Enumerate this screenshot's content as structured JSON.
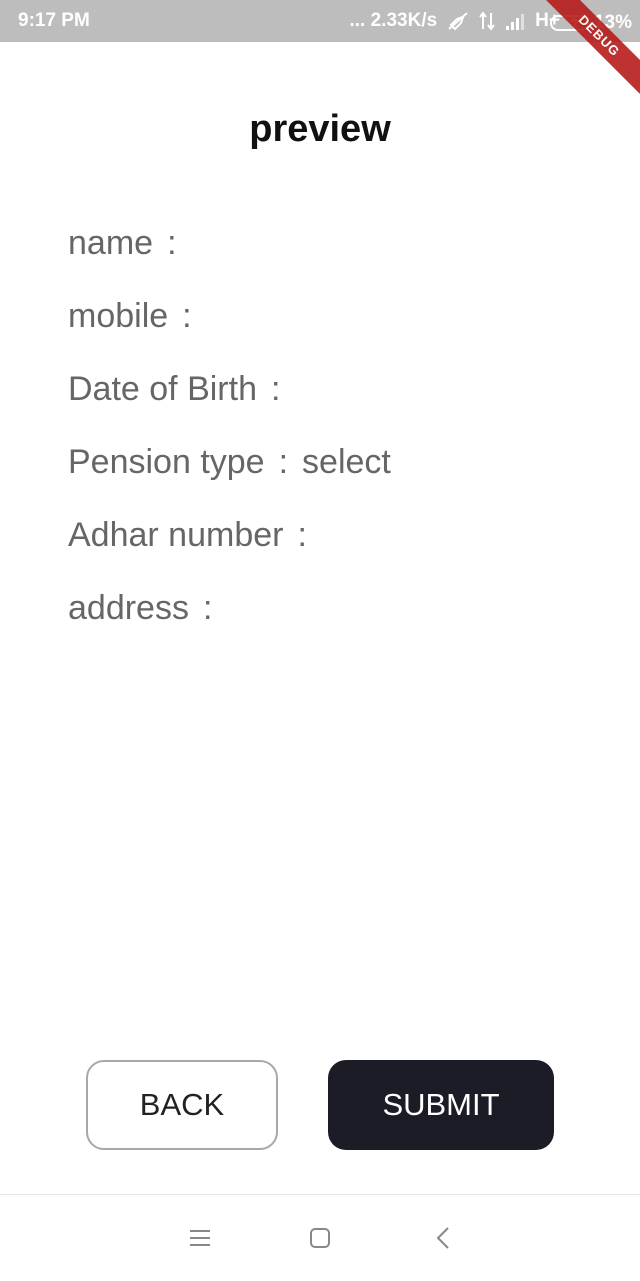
{
  "status_bar": {
    "time": "9:17 PM",
    "network_speed": "... 2.33K/s",
    "network_type": "H+",
    "battery_percent": "13%",
    "battery_level": 0.13,
    "icons": [
      "mute-icon",
      "data-arrows-icon",
      "signal-icon",
      "charging-icon",
      "battery-icon"
    ]
  },
  "debug_banner": "DEBUG",
  "page": {
    "title": "preview",
    "separator": ":",
    "fields": [
      {
        "label": "name",
        "value": ""
      },
      {
        "label": "mobile",
        "value": ""
      },
      {
        "label": "Date of Birth",
        "value": ""
      },
      {
        "label": "Pension type",
        "value": "select"
      },
      {
        "label": "Adhar number",
        "value": ""
      },
      {
        "label": "address",
        "value": ""
      }
    ]
  },
  "buttons": {
    "back_label": "BACK",
    "submit_label": "SUBMIT"
  },
  "nav_bar": {
    "icons": [
      "menu-icon",
      "home-icon",
      "back-icon"
    ]
  },
  "colors": {
    "status_bar": "#bdbdbd",
    "debug_banner": "#b71c1c",
    "submit_button": "#1c1c26",
    "label_text": "#666666"
  }
}
